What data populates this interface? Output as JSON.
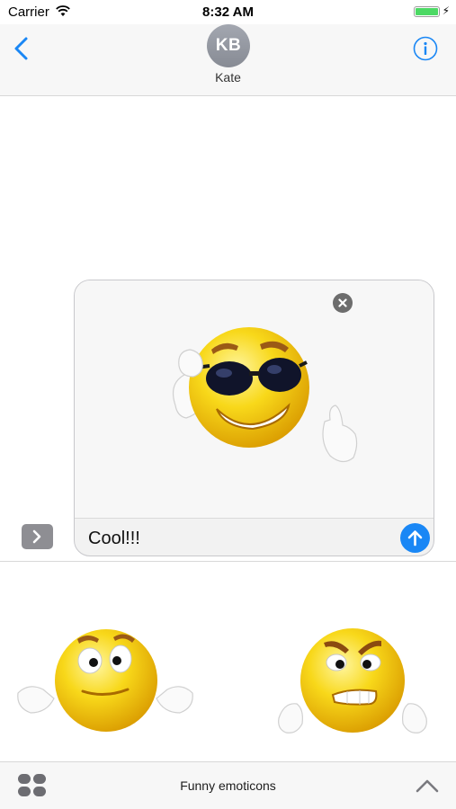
{
  "status_bar": {
    "carrier": "Carrier",
    "time": "8:32 AM",
    "battery_level": 1.0,
    "charging_icon": "bolt-icon"
  },
  "header": {
    "back_icon": "chevron-left-icon",
    "avatar_initials": "KB",
    "contact_name": "Kate",
    "info_icon": "info-circle-icon"
  },
  "compose": {
    "expand_icon": "chevron-right-icon",
    "attachment": "cool-emoticon-sticker-with-sunglasses",
    "remove_icon": "close-circle-icon",
    "message_text": "Cool!!!",
    "send_icon": "arrow-up-icon"
  },
  "sticker_drawer": {
    "stickers": [
      {
        "name": "confused-shrug-emoticon"
      },
      {
        "name": "angry-grimace-emoticon"
      }
    ],
    "title": "Funny emoticons",
    "apps_icon": "app-drawer-icon",
    "collapse_icon": "chevron-up-icon"
  },
  "colors": {
    "accent_blue": "#1a87f5",
    "send_blue": "#1a87f5",
    "avatar_gray": "#959aa3",
    "battery_green": "#4cd964",
    "emoji_yellow": "#f5c800"
  }
}
